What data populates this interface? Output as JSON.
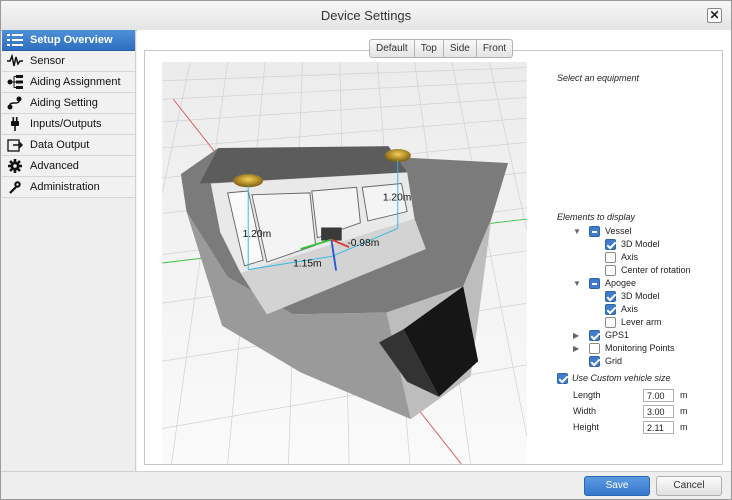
{
  "window": {
    "title": "Device Settings",
    "close_label": "✕"
  },
  "sidebar": {
    "items": [
      {
        "label": "Setup Overview",
        "icon": "list-icon",
        "active": true
      },
      {
        "label": "Sensor",
        "icon": "waveform-icon"
      },
      {
        "label": "Aiding Assignment",
        "icon": "tree-icon"
      },
      {
        "label": "Aiding Setting",
        "icon": "route-icon"
      },
      {
        "label": "Inputs/Outputs",
        "icon": "plug-icon"
      },
      {
        "label": "Data Output",
        "icon": "export-icon"
      },
      {
        "label": "Advanced",
        "icon": "gear-icon"
      },
      {
        "label": "Administration",
        "icon": "admin-icon"
      }
    ]
  },
  "view_tabs": [
    "Default",
    "Top",
    "Side",
    "Front"
  ],
  "viewport": {
    "measurements": {
      "m1": "1.20m",
      "m2": "1.20m",
      "m3": "-0.98m",
      "m4": "1.15m"
    }
  },
  "right_pane": {
    "select_prompt": "Select an equipment",
    "elements_title": "Elements to display",
    "tree": {
      "vessel": "Vessel",
      "vessel_3d": "3D Model",
      "vessel_axis": "Axis",
      "vessel_cor": "Center of rotation",
      "apogee": "Apogee",
      "apogee_3d": "3D Model",
      "apogee_axis": "Axis",
      "apogee_lever": "Lever arm",
      "gps1": "GPS1",
      "monitoring": "Monitoring Points",
      "grid": "Grid"
    },
    "custom_size_label": "Use Custom vehicle size",
    "length_label": "Length",
    "length_value": "7.00",
    "width_label": "Width",
    "width_value": "3.00",
    "height_label": "Height",
    "height_value": "2.11",
    "unit": "m"
  },
  "footer": {
    "save_label": "Save",
    "cancel_label": "Cancel"
  },
  "colors": {
    "accent": "#3a7dcf",
    "hull": "#8f8f8f",
    "cabin": "#e8e8e8"
  }
}
